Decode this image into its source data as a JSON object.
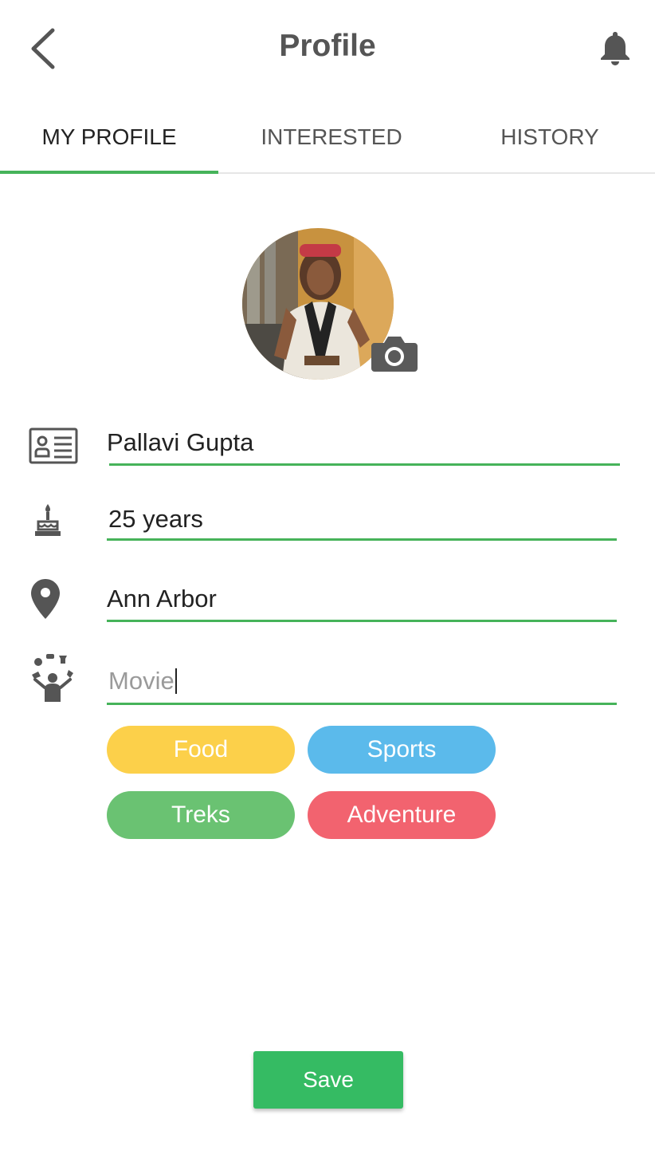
{
  "header": {
    "title": "Profile"
  },
  "tabs": [
    {
      "label": "MY PROFILE",
      "active": true
    },
    {
      "label": "INTERESTED",
      "active": false
    },
    {
      "label": "HISTORY",
      "active": false
    }
  ],
  "profile": {
    "name": "Pallavi Gupta",
    "age": "25 years",
    "location": "Ann Arbor",
    "interest_input": "Movie"
  },
  "interest_chips": [
    {
      "label": "Food",
      "color": "#fcd04a"
    },
    {
      "label": "Sports",
      "color": "#5bbaeb"
    },
    {
      "label": "Treks",
      "color": "#6ac272"
    },
    {
      "label": "Adventure",
      "color": "#f2636f"
    }
  ],
  "actions": {
    "save_label": "Save"
  },
  "theme": {
    "accent": "#46b35a",
    "save_button": "#35bb63",
    "icon_color": "#555555"
  }
}
